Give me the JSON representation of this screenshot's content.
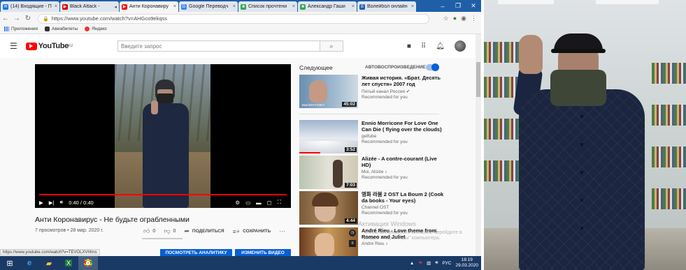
{
  "browser": {
    "tabs": [
      {
        "label": "(14) Входящие - П",
        "color": "#1a73e8",
        "glyph": "✉"
      },
      {
        "label": "Black Attack - ",
        "color": "#d00",
        "glyph": "▶"
      },
      {
        "label": "Анти Коронавиру",
        "color": "#f00",
        "glyph": "▶",
        "active": true
      },
      {
        "label": "Google Переводч",
        "color": "#4285f4",
        "glyph": "G"
      },
      {
        "label": "Список прочтени",
        "color": "#34a853",
        "glyph": "■"
      },
      {
        "label": "Александр Гаши",
        "color": "#34a853",
        "glyph": "■"
      },
      {
        "label": "Волейбол онлайн",
        "color": "#1a5fb4",
        "glyph": "B"
      }
    ],
    "url": "https://www.youtube.com/watch?v=AHGco9ekqss",
    "bookmarks": [
      "Приложения",
      "Авиабилеты",
      "Яндекс"
    ]
  },
  "youtube": {
    "logo": "YouTube",
    "logo_sup": "KZ",
    "search_placeholder": "Введите запрос",
    "video": {
      "title": "Анти Коронавирус - Не будьте ограбленными",
      "meta": "7 просмотров • 28 мар. 2020 г.",
      "time": "0:40 / 0:40",
      "progress": 1.0,
      "likes": "0",
      "dislikes": "0",
      "share": "ПОДЕЛИТЬСЯ",
      "save": "СОХРАНИТЬ"
    },
    "upnext": "Следующее",
    "autoplay": "АВТОВОСПРОИЗВЕДЕНИЕ",
    "recs": [
      {
        "title": "Живая история. «Брат. Десять лет спустя» 2007 год",
        "channel": "Пятый канал Россия ✔",
        "sub": "Recommended for you",
        "dur": "45:02",
        "thumb_text": "ВиктБРАТ2ЛЕТ"
      },
      {
        "title": "Ennio Morricone For Love One Can Die ( flying over the clouds)",
        "channel": "gelfube",
        "sub": "Recommended for you",
        "dur": "3:52"
      },
      {
        "title": "Alizée - A contre-courant (Live HD)",
        "channel": "Moi, Alizée ♪",
        "sub": "Recommended for you",
        "dur": "7:03"
      },
      {
        "title": "영화 라붐 2 OST La Boum 2 (Cook da books - Your eyes)",
        "channel": "Channel OST",
        "sub": "Recommended for you",
        "dur": "4:44"
      },
      {
        "title": "André Rieu - Love theme from Romeo and Juliet",
        "channel": "André Rieu ♪",
        "sub": "",
        "dur": ""
      }
    ],
    "watermark": "Активация Windows",
    "watermark_sub": "Чтобы активировать Windows, перейдите в раздел \"Параметры\" компьютера.",
    "status_url": "https://www.youtube.com/watch?v=TEVOLXVhhns",
    "btn_analytics": "ПОСМОТРЕТЬ АНАЛИТИКУ",
    "btn_edit": "ИЗМЕНИТЬ ВИДЕО"
  },
  "taskbar": {
    "lang": "РУС",
    "time": "18:19",
    "date": "29.03.2020"
  }
}
